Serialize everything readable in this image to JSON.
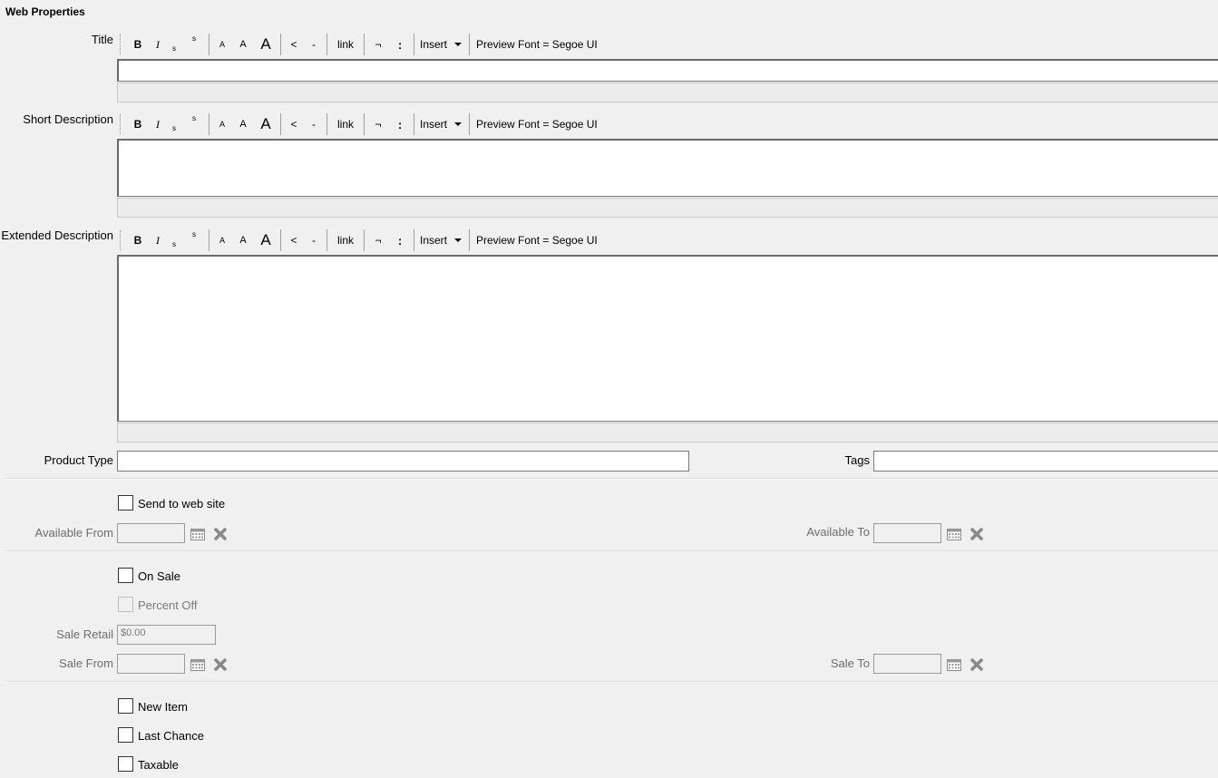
{
  "section_title": "Web Properties",
  "toolbar": {
    "bold": "B",
    "italic": "I",
    "subscript": "s",
    "superscript": "s",
    "font_small": "A",
    "font_medium": "A",
    "font_large": "A",
    "outdent": "<",
    "rule": "-",
    "link": "link",
    "not": "¬",
    "colon": ":",
    "insert": "Insert",
    "preview_font": "Preview Font = Segoe UI"
  },
  "fields": {
    "title_label": "Title",
    "short_description_label": "Short Description",
    "extended_description_label": "Extended Description",
    "product_type_label": "Product Type",
    "tags_label": "Tags"
  },
  "web": {
    "send_label": "Send to web site",
    "available_from_label": "Available From",
    "available_to_label": "Available To"
  },
  "sale": {
    "on_sale_label": "On Sale",
    "percent_off_label": "Percent Off",
    "sale_retail_label": "Sale Retail",
    "sale_retail_value": "$0.00",
    "sale_from_label": "Sale From",
    "sale_to_label": "Sale To"
  },
  "flags": {
    "new_item_label": "New Item",
    "last_chance_label": "Last Chance",
    "taxable_label": "Taxable"
  },
  "icons": {
    "calendar": "calendar-icon",
    "clear": "clear-x-icon"
  }
}
